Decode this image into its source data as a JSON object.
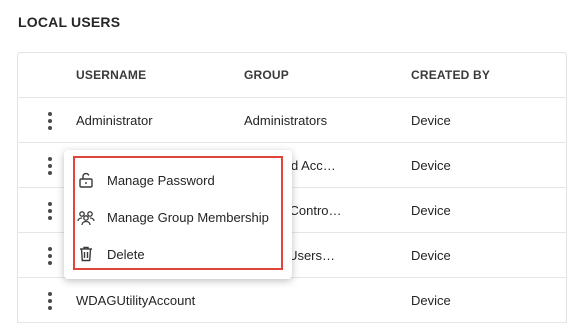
{
  "section": {
    "title": "LOCAL USERS"
  },
  "table": {
    "columns": [
      "USERNAME",
      "GROUP",
      "CREATED BY"
    ],
    "rows": [
      {
        "username": "Administrator",
        "group": "Administrators",
        "created_by": "Device"
      },
      {
        "username": "",
        "group": "Managed Acc…",
        "created_by": "Device"
      },
      {
        "username": "",
        "group": "Access Contro…",
        "created_by": "Device"
      },
      {
        "username": "",
        "group": "trators, Users…",
        "created_by": "Device"
      },
      {
        "username": "WDAGUtilityAccount",
        "group": "",
        "created_by": "Device"
      }
    ]
  },
  "context_menu": {
    "items": [
      {
        "label": "Manage Password",
        "icon": "unlock-icon"
      },
      {
        "label": "Manage Group Membership",
        "icon": "group-icon"
      },
      {
        "label": "Delete",
        "icon": "trash-icon"
      }
    ],
    "highlight_color": "#e0453b"
  }
}
